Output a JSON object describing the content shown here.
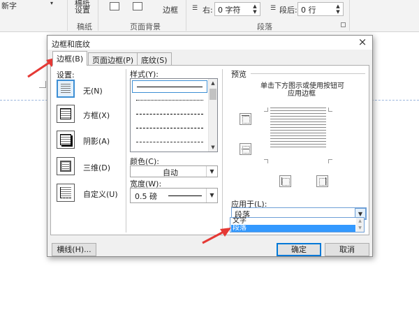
{
  "ribbon": {
    "font_fragment": "新字",
    "font_dd": "▾",
    "groups": {
      "draft_top": "稿纸",
      "draft_label": "设置",
      "draft_group": "稿纸",
      "bg_group": "页面背景",
      "border_btn": "边框",
      "para_group": "段落"
    },
    "indent_right_label": "右:",
    "indent_right_value": "0 字符",
    "spacing_after_label": "段后:",
    "spacing_after_value": "0 行"
  },
  "dialog": {
    "title": "边框和底纹",
    "close": "×",
    "tabs": [
      {
        "label": "边框(B)"
      },
      {
        "label": "页面边框(P)"
      },
      {
        "label": "底纹(S)"
      }
    ],
    "settings_label": "设置:",
    "settings": [
      {
        "label": "无(N)"
      },
      {
        "label": "方框(X)"
      },
      {
        "label": "阴影(A)"
      },
      {
        "label": "三维(D)"
      },
      {
        "label": "自定义(U)"
      }
    ],
    "style_label": "样式(Y):",
    "color_label": "颜色(C):",
    "color_value": "自动",
    "width_label": "宽度(W):",
    "width_value": "0.5 磅",
    "preview_label": "预览",
    "preview_hint_1": "单击下方图示或使用按钮可",
    "preview_hint_2": "应用边框",
    "apply_label": "应用于(L):",
    "apply_value": "段落",
    "apply_options": [
      "文字",
      "段落"
    ],
    "hline_button": "横线(H)...",
    "ok_button": "确定",
    "cancel_button": "取消"
  },
  "colors": {
    "accent": "#3c8ed4",
    "highlight": "#3399ff",
    "arrow": "#e53935"
  }
}
